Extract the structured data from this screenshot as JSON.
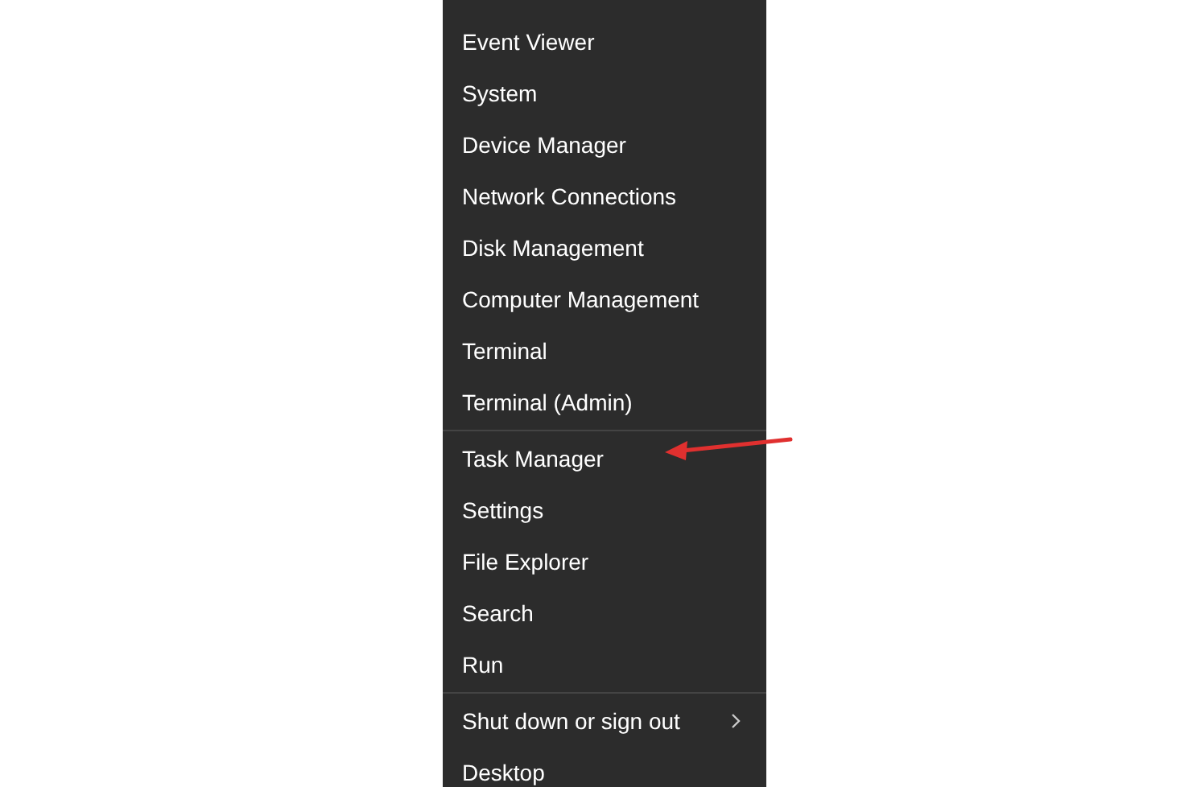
{
  "menu": {
    "sections": [
      {
        "items": [
          {
            "label": "Event Viewer",
            "has_submenu": false
          },
          {
            "label": "System",
            "has_submenu": false
          },
          {
            "label": "Device Manager",
            "has_submenu": false
          },
          {
            "label": "Network Connections",
            "has_submenu": false
          },
          {
            "label": "Disk Management",
            "has_submenu": false
          },
          {
            "label": "Computer Management",
            "has_submenu": false
          },
          {
            "label": "Terminal",
            "has_submenu": false
          },
          {
            "label": "Terminal (Admin)",
            "has_submenu": false
          }
        ]
      },
      {
        "items": [
          {
            "label": "Task Manager",
            "has_submenu": false
          },
          {
            "label": "Settings",
            "has_submenu": false
          },
          {
            "label": "File Explorer",
            "has_submenu": false
          },
          {
            "label": "Search",
            "has_submenu": false
          },
          {
            "label": "Run",
            "has_submenu": false
          }
        ]
      },
      {
        "items": [
          {
            "label": "Shut down or sign out",
            "has_submenu": true
          },
          {
            "label": "Desktop",
            "has_submenu": false
          }
        ]
      }
    ]
  }
}
